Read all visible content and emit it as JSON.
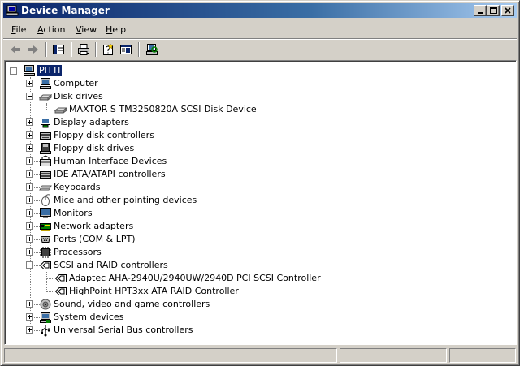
{
  "window": {
    "title": "Device Manager"
  },
  "menu": [
    {
      "label_pre": "",
      "accel": "F",
      "label_post": "ile"
    },
    {
      "label_pre": "",
      "accel": "A",
      "label_post": "ction"
    },
    {
      "label_pre": "",
      "accel": "V",
      "label_post": "iew"
    },
    {
      "label_pre": "",
      "accel": "H",
      "label_post": "elp"
    }
  ],
  "toolbar": [
    "back-icon",
    "forward-icon",
    "show-hide-console-tree-icon",
    "print-icon",
    "properties-icon",
    "help-icon",
    "scan-hardware-icon"
  ],
  "tree": {
    "root": {
      "label": "PITTI",
      "icon": "computer-icon",
      "expanded": true,
      "selected": true
    },
    "items": [
      {
        "label": "Computer",
        "icon": "computer-icon",
        "expanded": false
      },
      {
        "label": "Disk drives",
        "icon": "disk-drive-icon",
        "expanded": true,
        "children": [
          {
            "label": "MAXTOR S TM3250820A SCSI Disk Device",
            "icon": "disk-drive-icon"
          }
        ]
      },
      {
        "label": "Display adapters",
        "icon": "display-adapter-icon",
        "expanded": false
      },
      {
        "label": "Floppy disk controllers",
        "icon": "floppy-controller-icon",
        "expanded": false
      },
      {
        "label": "Floppy disk drives",
        "icon": "floppy-drive-icon",
        "expanded": false
      },
      {
        "label": "Human Interface Devices",
        "icon": "hid-icon",
        "expanded": false
      },
      {
        "label": "IDE ATA/ATAPI controllers",
        "icon": "ide-controller-icon",
        "expanded": false
      },
      {
        "label": "Keyboards",
        "icon": "keyboard-icon",
        "expanded": false
      },
      {
        "label": "Mice and other pointing devices",
        "icon": "mouse-icon",
        "expanded": false
      },
      {
        "label": "Monitors",
        "icon": "monitor-icon",
        "expanded": false
      },
      {
        "label": "Network adapters",
        "icon": "network-adapter-icon",
        "expanded": false
      },
      {
        "label": "Ports (COM & LPT)",
        "icon": "port-icon",
        "expanded": false
      },
      {
        "label": "Processors",
        "icon": "processor-icon",
        "expanded": false
      },
      {
        "label": "SCSI and RAID controllers",
        "icon": "scsi-icon",
        "expanded": true,
        "children": [
          {
            "label": "Adaptec AHA-2940U/2940UW/2940D PCI SCSI Controller",
            "icon": "scsi-icon"
          },
          {
            "label": "HighPoint HPT3xx ATA RAID Controller",
            "icon": "scsi-icon"
          }
        ]
      },
      {
        "label": "Sound, video and game controllers",
        "icon": "sound-icon",
        "expanded": false
      },
      {
        "label": "System devices",
        "icon": "system-device-icon",
        "expanded": false
      },
      {
        "label": "Universal Serial Bus controllers",
        "icon": "usb-icon",
        "expanded": false
      }
    ]
  },
  "colors": {
    "titlebar_start": "#0a246a",
    "titlebar_end": "#a6caf0",
    "face": "#d4d0c8",
    "selection": "#0a246a"
  }
}
